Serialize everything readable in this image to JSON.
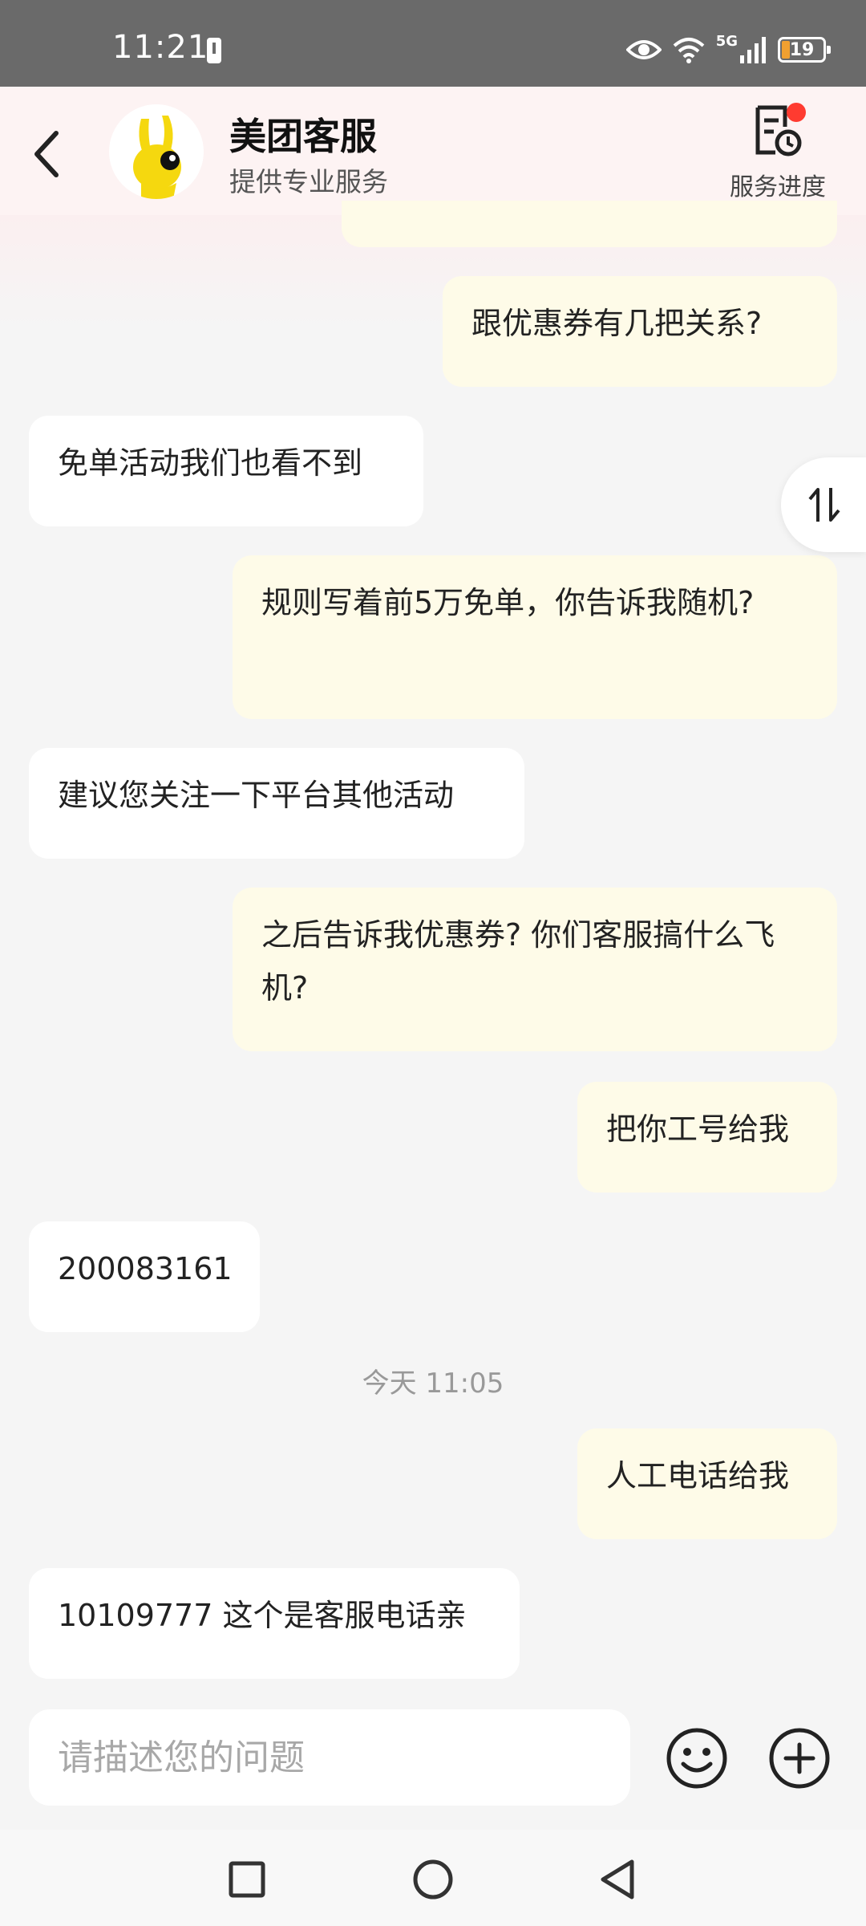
{
  "status_bar": {
    "time": "11:21",
    "battery": "19",
    "network": "5G"
  },
  "header": {
    "title": "美团客服",
    "subtitle": "提供专业服务",
    "progress_label": "服务进度"
  },
  "messages": [
    {
      "from": "me",
      "text": "跟优惠券有几把关系?"
    },
    {
      "from": "bot",
      "text": "免单活动我们也看不到"
    },
    {
      "from": "me",
      "text": "规则写着前5万免单，你告诉我随机?"
    },
    {
      "from": "bot",
      "text": "建议您关注一下平台其他活动"
    },
    {
      "from": "me",
      "text": "之后告诉我优惠券? 你们客服搞什么飞机?"
    },
    {
      "from": "me",
      "text": "把你工号给我"
    },
    {
      "from": "bot",
      "text": "200083161"
    },
    {
      "from": "me",
      "text": "人工电话给我"
    },
    {
      "from": "bot",
      "text": "10109777 这个是客服电话亲"
    }
  ],
  "timestamp": "今天 11:05",
  "input": {
    "placeholder": "请描述您的问题"
  },
  "icons": {
    "back": "chevron-left-icon",
    "progress": "document-clock-icon",
    "emoji": "smiley-icon",
    "plus": "plus-circle-icon",
    "scroll": "swap-vertical-icon"
  },
  "colors": {
    "my_bubble": "#fefbe8",
    "bot_bubble": "#ffffff",
    "notification_dot": "#ff3b30"
  }
}
